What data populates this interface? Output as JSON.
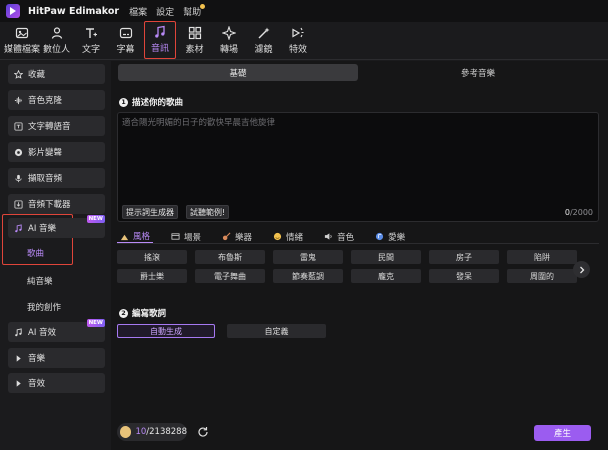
{
  "app": {
    "title": "HitPaw Edimakor"
  },
  "menu": [
    {
      "label": "檔案"
    },
    {
      "label": "設定"
    },
    {
      "label": "幫助"
    }
  ],
  "toolbar": [
    {
      "label": "媒體檔案",
      "icon": "media-icon"
    },
    {
      "label": "數位人",
      "icon": "avatar-icon"
    },
    {
      "label": "文字",
      "icon": "text-icon"
    },
    {
      "label": "字幕",
      "icon": "subtitle-icon"
    },
    {
      "label": "音訊",
      "icon": "audio-icon",
      "active": true
    },
    {
      "label": "素材",
      "icon": "assets-icon"
    },
    {
      "label": "轉場",
      "icon": "transition-icon"
    },
    {
      "label": "濾鏡",
      "icon": "filter-icon"
    },
    {
      "label": "特效",
      "icon": "effects-icon"
    }
  ],
  "sidebar": {
    "items": [
      {
        "label": "收藏",
        "icon": "star-icon"
      },
      {
        "label": "音色克隆",
        "icon": "clone-icon"
      },
      {
        "label": "文字轉語音",
        "icon": "tts-icon"
      },
      {
        "label": "影片變聲",
        "icon": "voice-change-icon"
      },
      {
        "label": "擷取音頻",
        "icon": "extract-icon"
      },
      {
        "label": "音頻下載器",
        "icon": "download-icon"
      }
    ],
    "ai_music": {
      "label": "AI 音樂",
      "badge": "NEW",
      "icon": "ai-music-icon"
    },
    "ai_music_sub": [
      {
        "label": "歌曲",
        "active": true
      },
      {
        "label": "純音樂"
      },
      {
        "label": "我的創作"
      }
    ],
    "ai_sfx": {
      "label": "AI 音效",
      "badge": "NEW",
      "icon": "ai-sfx-icon"
    },
    "music": {
      "label": "音樂"
    },
    "sfx": {
      "label": "音效"
    }
  },
  "main": {
    "tabs": [
      {
        "label": "基礎",
        "active": true
      },
      {
        "label": "參考音樂"
      }
    ],
    "section1": {
      "num": "1",
      "title": "描述你的歌曲"
    },
    "textarea": {
      "placeholder": "適合陽光明媚的日子的歡快早晨吉他旋律",
      "btn_prompt": "提示詞生成器",
      "btn_example": "試聽範例!",
      "count": "0",
      "max": "/2000"
    },
    "categories": [
      {
        "label": "風格",
        "active": true
      },
      {
        "label": "場景"
      },
      {
        "label": "樂器"
      },
      {
        "label": "情緒"
      },
      {
        "label": "音色"
      },
      {
        "label": "愛樂"
      }
    ],
    "chips": [
      "搖滾",
      "布魯斯",
      "雷鬼",
      "民間",
      "房子",
      "陷阱",
      "爵士樂",
      "電子舞曲",
      "節奏藍調",
      "龐克",
      "發呆",
      "周圍的"
    ],
    "section2": {
      "num": "2",
      "title": "編寫歌詞"
    },
    "mode_auto": "自動生成",
    "mode_custom": "自定義"
  },
  "footer": {
    "credits_used": "10",
    "credits_total": "/2138288",
    "generate": "產生"
  },
  "colors": {
    "accent": "#9b5cf0",
    "highlight_box": "#e0453a"
  }
}
